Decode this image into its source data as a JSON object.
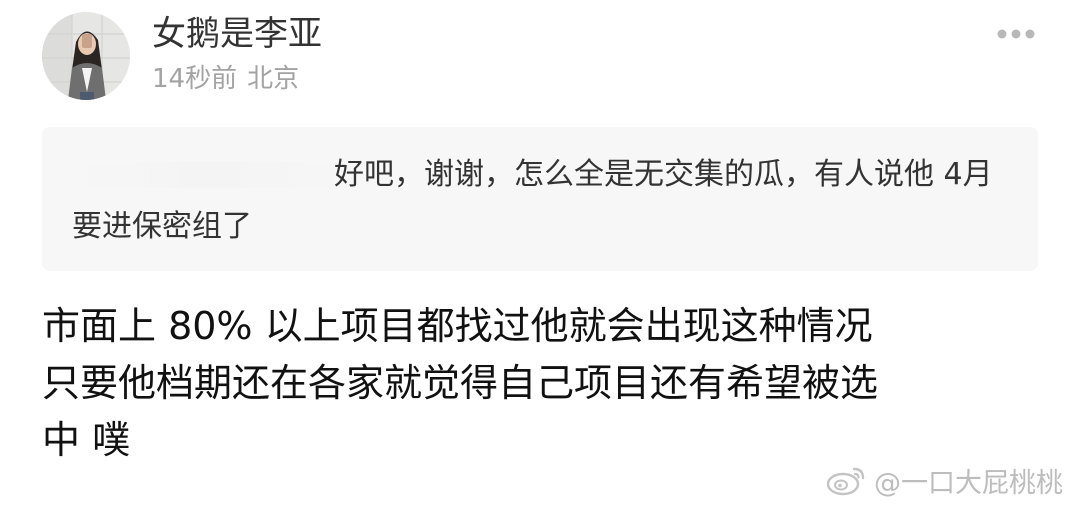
{
  "post": {
    "author": {
      "name": "女鹅是李亚",
      "avatar": "avatar-photo"
    },
    "meta": {
      "time": "14秒前",
      "location": "北京"
    },
    "more_icon": "more-dots-icon",
    "quote": {
      "text": "好吧，谢谢，怎么全是无交集的瓜，有人说他 4月要进保密组了"
    },
    "body": {
      "line1": "市面上 80% 以上项目都找过他就会出现这种情况",
      "line2": "只要他档期还在各家就觉得自己项目还有希望被选",
      "line3": "中 噗"
    }
  },
  "watermark": {
    "icon": "weibo-logo-icon",
    "text": "@一口大屁桃桃"
  },
  "colors": {
    "background": "#ffffff",
    "quote_background": "#f7f7f7",
    "meta_gray": "#a3a3a3",
    "watermark_gray": "#bdbdbd"
  }
}
